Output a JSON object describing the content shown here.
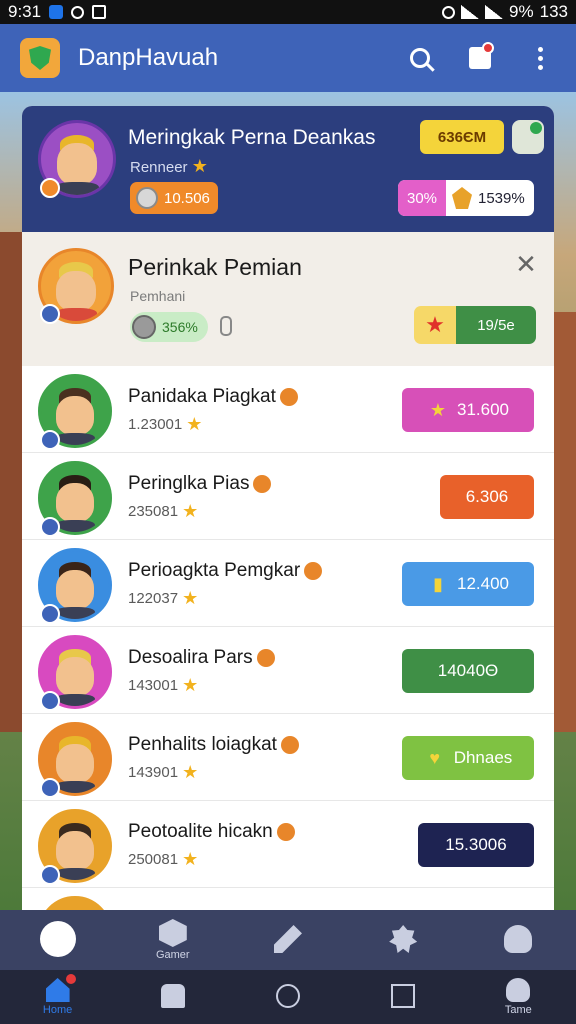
{
  "status_bar": {
    "time": "9:31",
    "battery": "9%",
    "battery_extra": "133"
  },
  "app": {
    "title": "DanpHavuah"
  },
  "top_card": {
    "name": "Meringkak Perna Deankas",
    "subtitle": "Renneer",
    "coins": "10.506",
    "points": "636ЄM",
    "percent": "30%",
    "stat": "1539%"
  },
  "featured": {
    "name": "Perinkak Pemian",
    "subtitle": "Pemhani",
    "progress": "356%",
    "reward": "19/5e"
  },
  "rows": [
    {
      "name": "Panidaka Piagkat",
      "score": "1.23001",
      "badge": "31.600",
      "badge_color": "#d750b8",
      "ring": "#3ea34a"
    },
    {
      "name": "Peringlka Pias",
      "score": "235081",
      "badge": "6.306",
      "badge_color": "#e8612a",
      "ring": "#3ea34a"
    },
    {
      "name": "Perioagkta Pemgkar",
      "score": "122037",
      "badge": "12.400",
      "badge_color": "#4a9ae6",
      "ring": "#3a8de0"
    },
    {
      "name": "Desoalira Pars",
      "score": "143001",
      "badge": "14040Θ",
      "badge_color": "#3f8f46",
      "ring": "#d84ac0"
    },
    {
      "name": "Penhalits loiagkat",
      "score": "143901",
      "badge": "Dhnaes",
      "badge_color": "#7fc242",
      "ring": "#e8862a"
    },
    {
      "name": "Peotoalite hicakn",
      "score": "250081",
      "badge": "15.3006",
      "badge_color": "#1e2352",
      "ring": "#e8a22a"
    }
  ],
  "bottom_nav": {
    "items": [
      {
        "label": "",
        "icon": "avatar-icon"
      },
      {
        "label": "Gamer",
        "icon": "box-icon"
      },
      {
        "label": "",
        "icon": "pen-icon"
      },
      {
        "label": "",
        "icon": "badge-icon"
      },
      {
        "label": "",
        "icon": "user-icon"
      }
    ]
  },
  "system_nav": {
    "items": [
      {
        "label": "Home",
        "icon": "home-icon"
      },
      {
        "label": "",
        "icon": "gamepad-icon"
      },
      {
        "label": "",
        "icon": "circle-icon"
      },
      {
        "label": "",
        "icon": "square-icon"
      },
      {
        "label": "Tame",
        "icon": "profile-icon"
      }
    ]
  }
}
